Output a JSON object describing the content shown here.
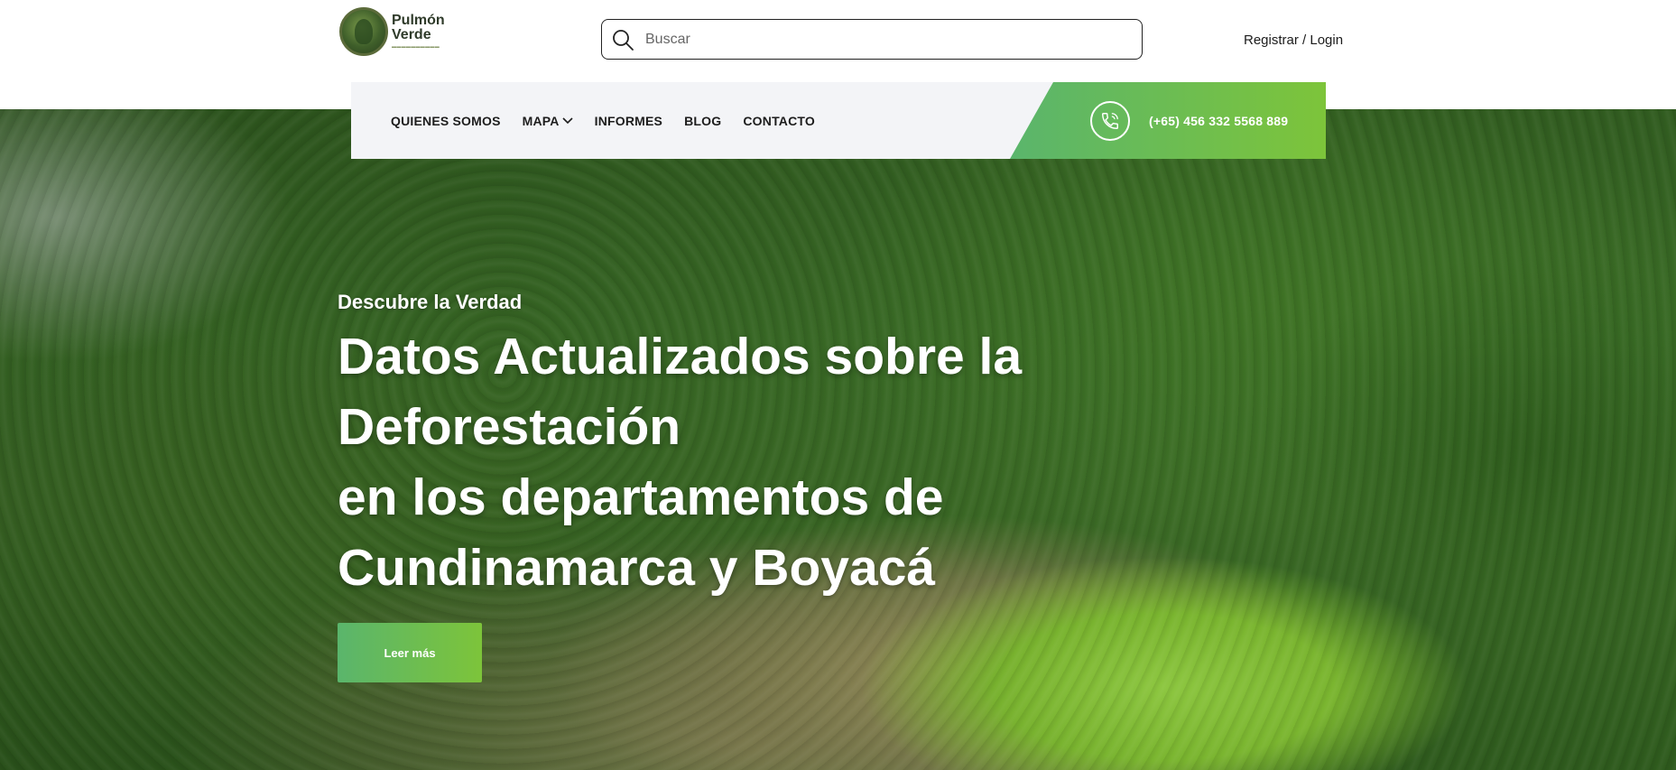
{
  "brand": {
    "name": "Pulmón Verde",
    "logo_icon": "forest-globe-logo"
  },
  "search": {
    "placeholder": "Buscar",
    "icon": "search-icon"
  },
  "auth": {
    "label": "Registrar / Login"
  },
  "nav": {
    "items": [
      {
        "label": "QUIENES SOMOS",
        "has_dropdown": false
      },
      {
        "label": "MAPA",
        "has_dropdown": true
      },
      {
        "label": "INFORMES",
        "has_dropdown": false
      },
      {
        "label": "BLOG",
        "has_dropdown": false
      },
      {
        "label": "CONTACTO",
        "has_dropdown": false
      }
    ],
    "phone": {
      "icon": "phone-icon",
      "number": "(+65) 456 332 5568 889"
    }
  },
  "hero": {
    "eyebrow": "Descubre la Verdad",
    "headline_lines": [
      "Datos Actualizados sobre la",
      "Deforestación",
      "en los departamentos de",
      "Cundinamarca y Boyacá"
    ],
    "cta_label": "Leer más"
  },
  "colors": {
    "accent_start": "#5ab56c",
    "accent_end": "#7dc43a",
    "nav_bg": "#f3f4f7",
    "text_dark": "#1d1d1d"
  }
}
